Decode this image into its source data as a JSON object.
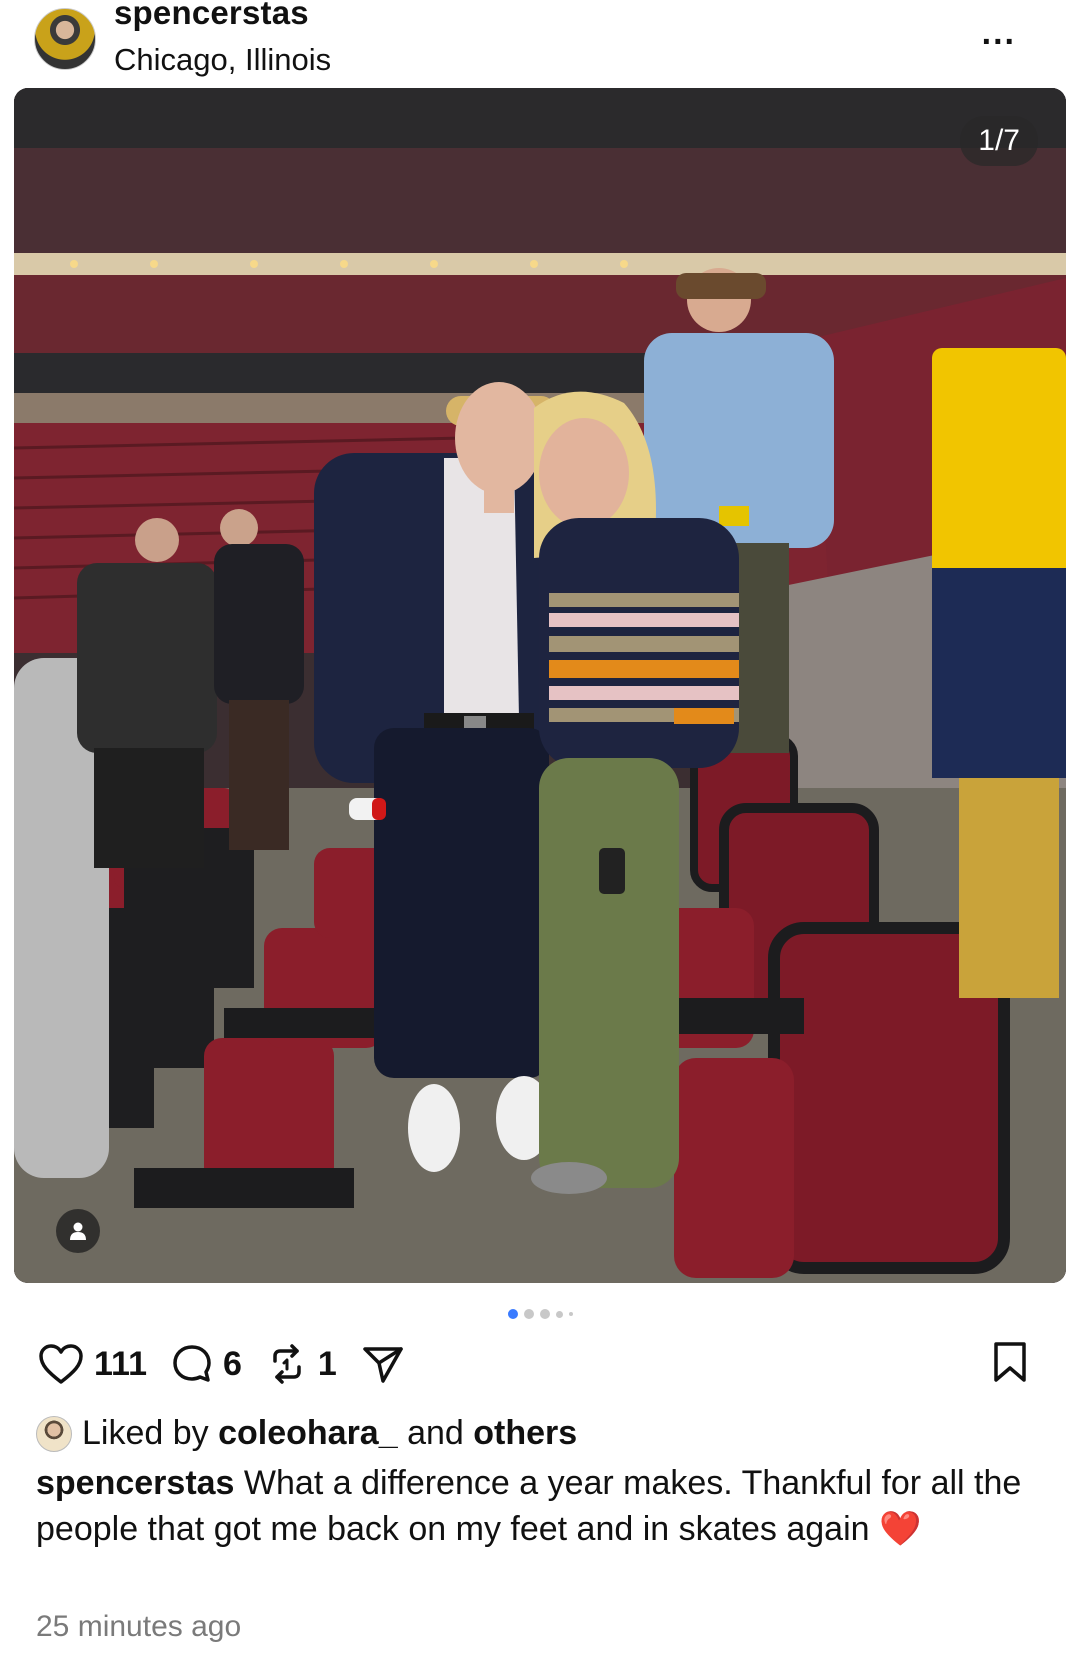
{
  "header": {
    "username": "spencerstas",
    "location": "Chicago, Illinois",
    "more_label": "..."
  },
  "photo": {
    "counter": "1/7",
    "description_icon": "person-tag-icon"
  },
  "carousel": {
    "total_dots": 5,
    "active_index": 0
  },
  "actions": {
    "likes_count": "111",
    "comments_count": "6",
    "reposts_count": "1",
    "icons": [
      "heart-icon",
      "comment-icon",
      "repost-icon",
      "share-icon",
      "bookmark-icon"
    ]
  },
  "liked_by": {
    "prefix": "Liked by",
    "user": "coleohara_",
    "middle": "and",
    "suffix": "others"
  },
  "caption": {
    "username": "spencerstas",
    "text": "What a difference a year makes. Thankful for all the people that got me back on my feet and in skates again",
    "emoji": "❤️"
  },
  "timestamp": "25 minutes ago",
  "colors": {
    "accent_dot": "#3a7bff",
    "seat_red": "#8b1e2b",
    "time_gray": "#7a7a7a"
  }
}
